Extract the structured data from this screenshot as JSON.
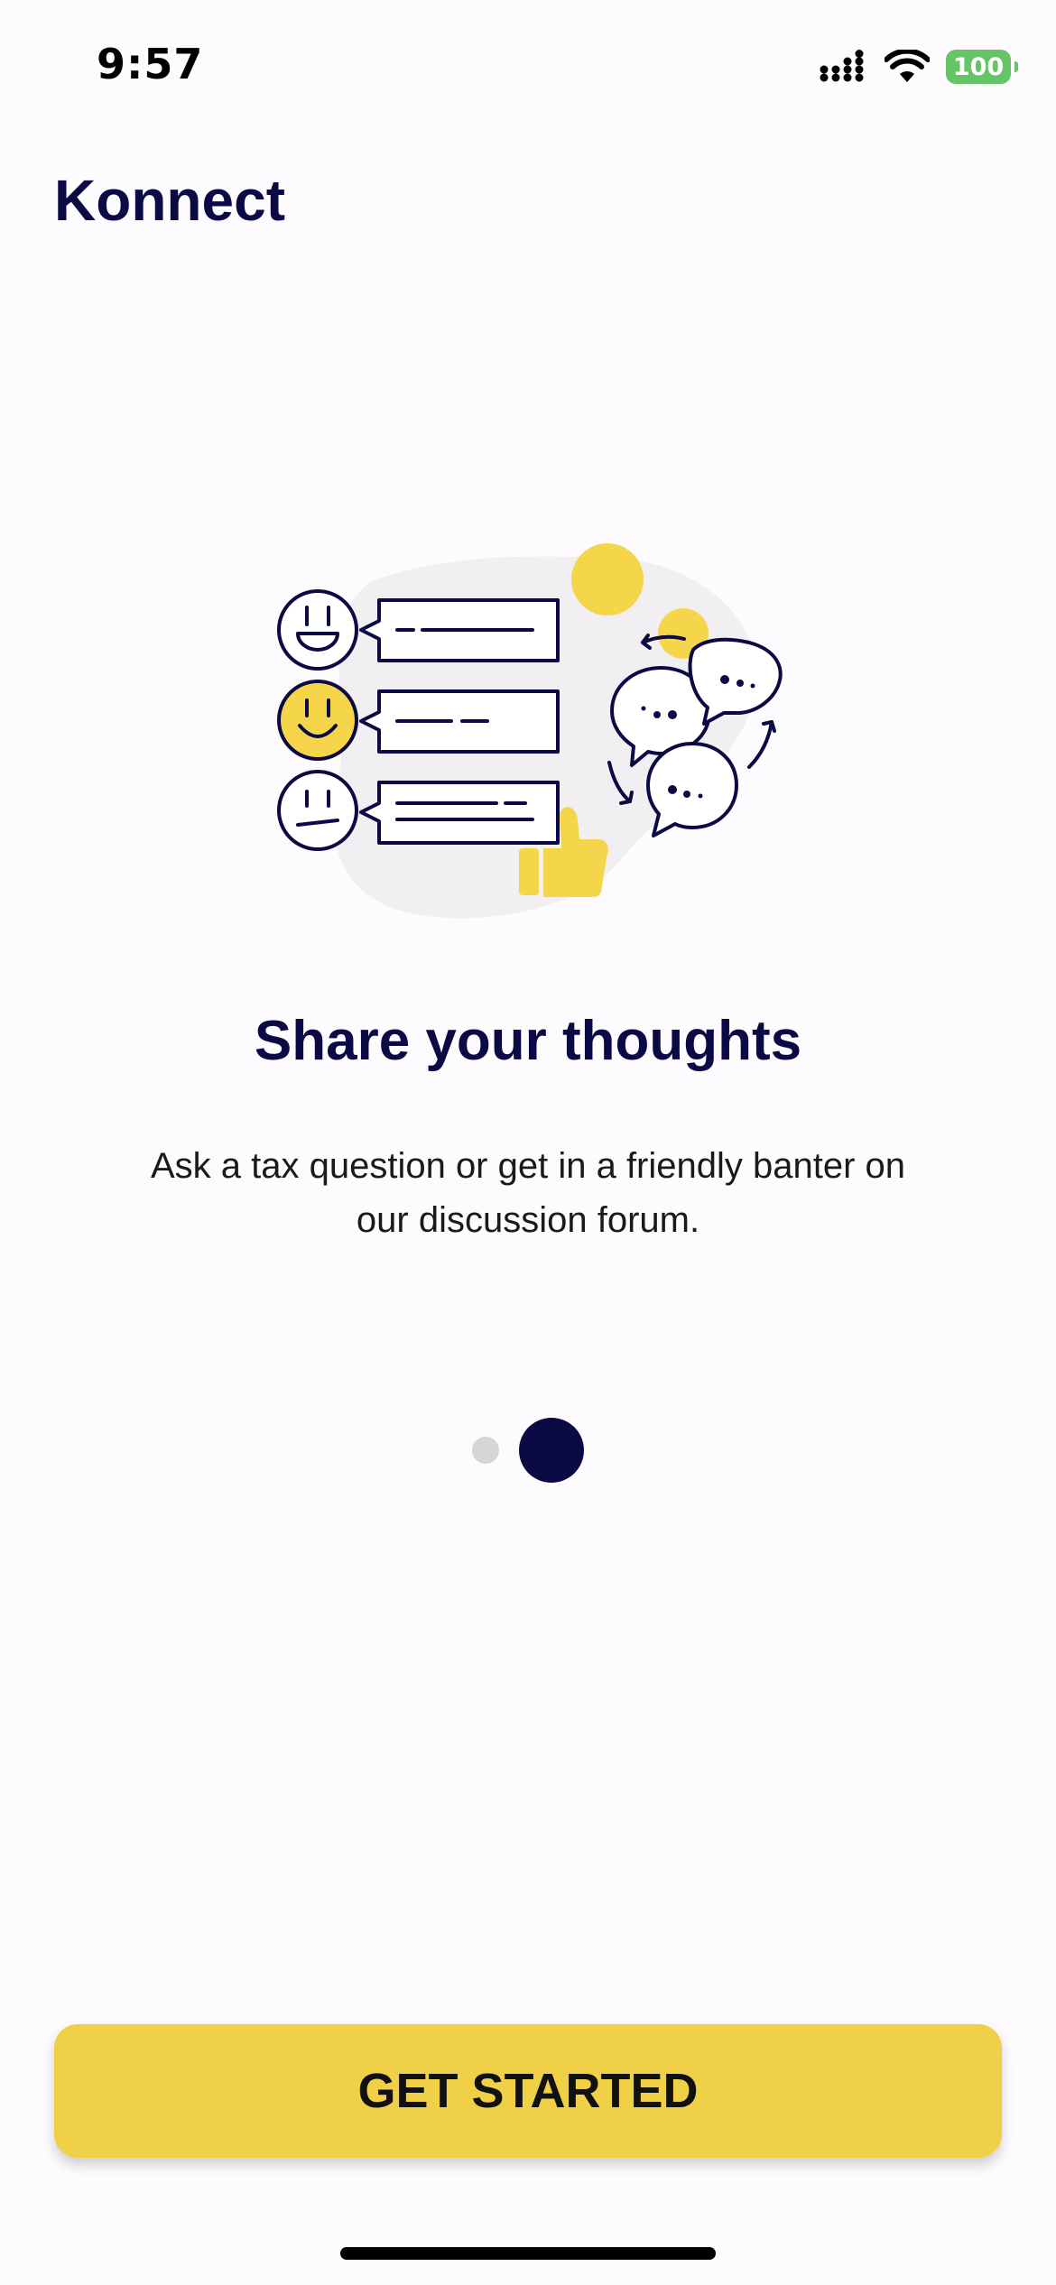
{
  "status_bar": {
    "time": "9:57",
    "icons": [
      "signal-icon",
      "wifi-icon",
      "battery-icon"
    ],
    "battery_level": "100",
    "battery_color": "#65c466"
  },
  "header": {
    "app_title": "Konnect"
  },
  "onboarding": {
    "illustration": "discussion-forum-illustration",
    "title": "Share your thoughts",
    "description": "Ask a tax question or get in a friendly banter on our discussion forum.",
    "page_total": 2,
    "page_active": 2
  },
  "cta": {
    "label": "GET STARTED"
  },
  "colors": {
    "primary": "#0b0a45",
    "accent": "#f0d046",
    "background": "#fdfbfd",
    "inactive_dot": "#d6d6d6"
  }
}
